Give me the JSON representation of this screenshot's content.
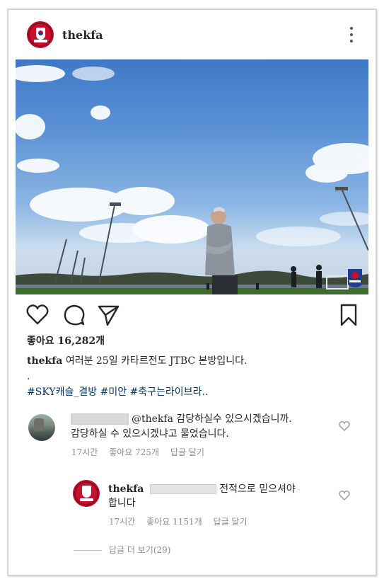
{
  "post": {
    "username": "thekfa",
    "likes_label": "좋아요 16,282개",
    "caption_user": "thekfa",
    "caption_text": "여러분 25일 카타르전도 JTBC 본방입니다.",
    "caption_dot": ".",
    "hashtags": "#SKY캐슬_결방 #미안 #축구는라이브라.."
  },
  "comments": [
    {
      "mention": "@thekfa",
      "text_line1": "감당하실수 있으시겠습니까.",
      "text_line2": "감당하실 수 있으시겠냐고 물었습니다.",
      "time": "17시간",
      "likes": "좋아요 725개",
      "reply": "답글 달기"
    },
    {
      "username": "thekfa",
      "text_line1": "전적으로 믿으셔야",
      "text_line2": "합니다",
      "time": "17시간",
      "likes": "좋아요 1151개",
      "reply": "답글 달기"
    }
  ],
  "more_replies": "답글 더 보기(29)",
  "icons": {
    "more": "more-options-icon",
    "like": "heart-icon",
    "comment": "comment-icon",
    "share": "send-icon",
    "bookmark": "bookmark-icon"
  },
  "colors": {
    "hashtag": "#003569",
    "meta": "#8e8e8e",
    "brand_red": "#c8102e"
  }
}
